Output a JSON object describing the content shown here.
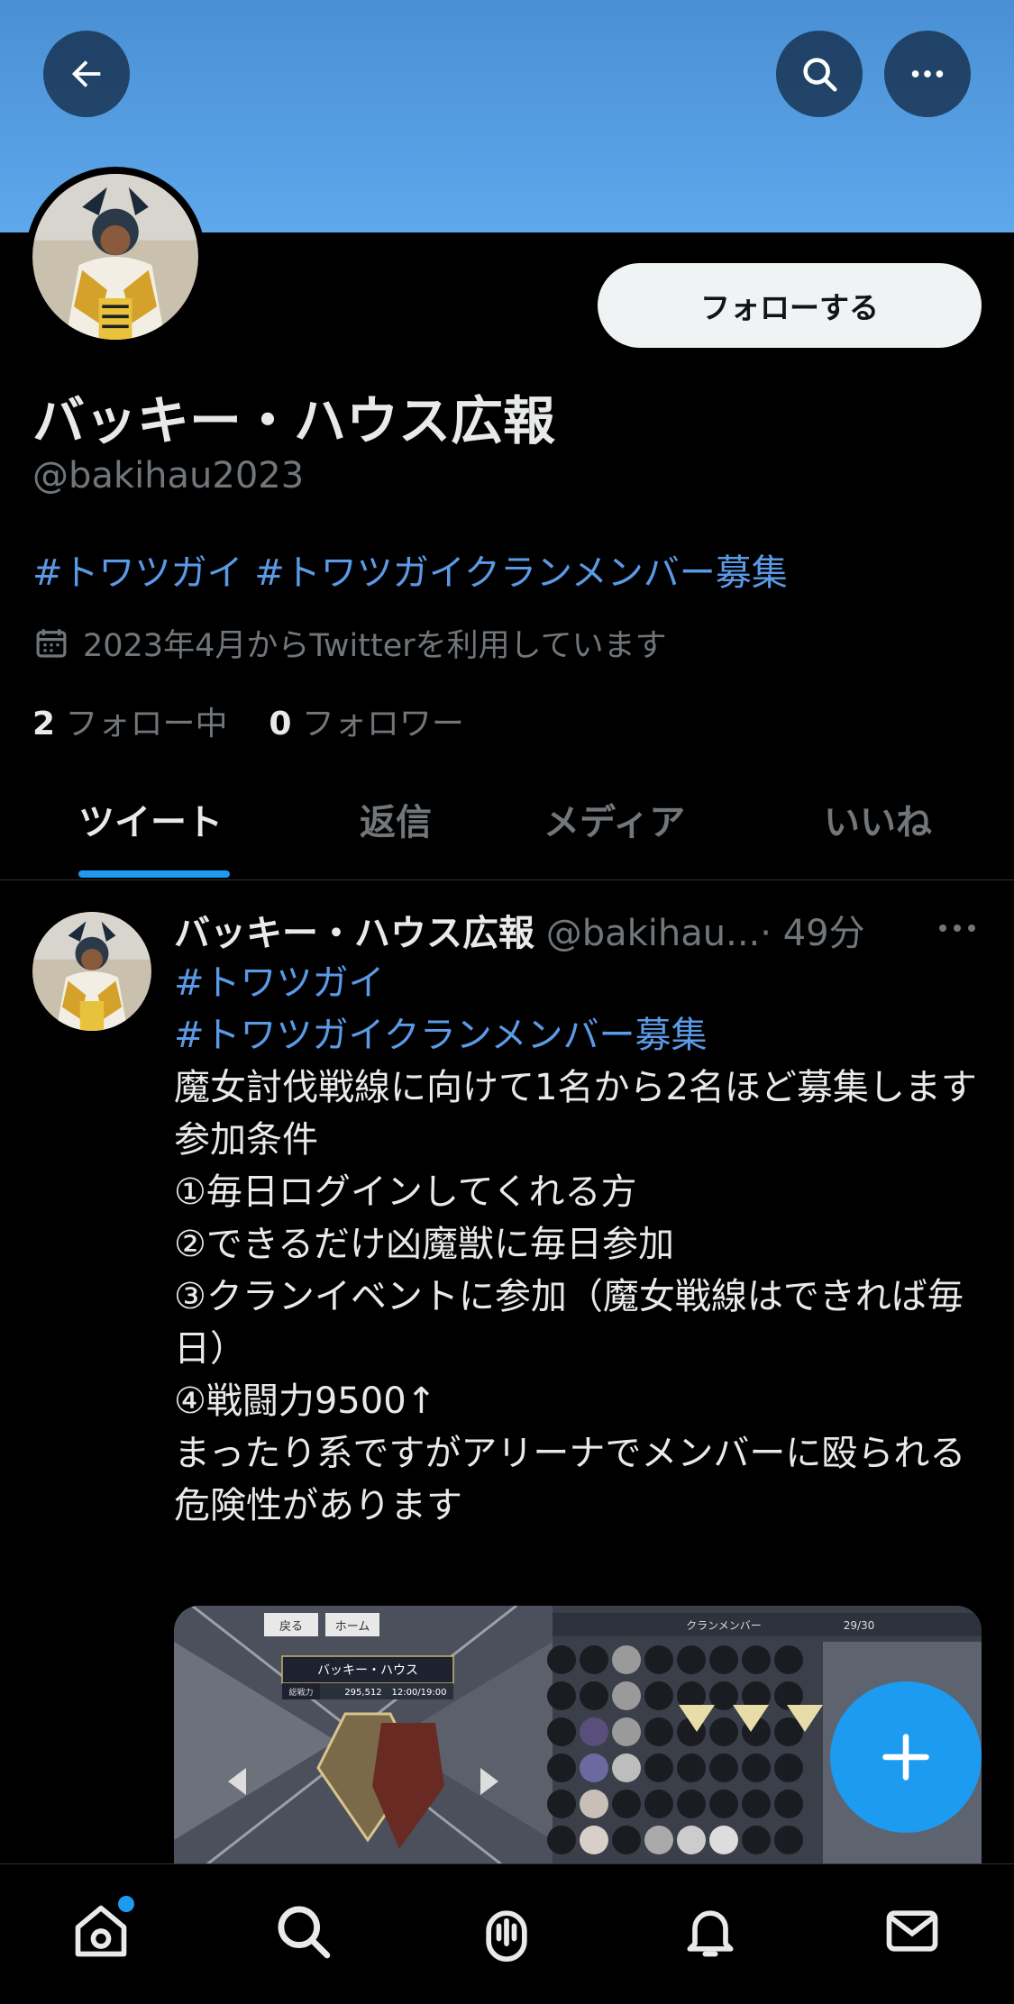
{
  "colors": {
    "accent": "#1d9bf0",
    "link": "#5b9ae6",
    "banner": "#5ea8ec"
  },
  "header": {
    "back_icon": "arrow-left-icon",
    "search_icon": "search-icon",
    "more_icon": "more-horizontal-icon"
  },
  "profile": {
    "follow_label": "フォローする",
    "display_name": "バッキー・ハウス広報",
    "handle": "@bakihau2023",
    "bio": "#トワツガイ #トワツガイクランメンバー募集",
    "joined": "2023年4月からTwitterを利用しています",
    "following_count": "2",
    "following_label": "フォロー中",
    "followers_count": "0",
    "followers_label": "フォロワー"
  },
  "tabs": [
    "ツイート",
    "返信",
    "メディア",
    "いいね"
  ],
  "tweet": {
    "author_name": "バッキー・ハウス広報",
    "author_handle": "@bakihau...",
    "time": "· 49分",
    "hashtag1": "#トワツガイ",
    "hashtag2": "#トワツガイクランメンバー募集",
    "lines": [
      "魔女討伐戦線に向けて1名から2名ほど募集します",
      "参加条件",
      "①毎日ログインしてくれる方",
      "②できるだけ凶魔獣に毎日参加",
      "③クランイベントに参加（魔女戦線はできれば毎日）",
      "④戦闘力9500↑",
      "まったり系ですがアリーナでメンバーに殴られる危険性があります"
    ],
    "media": {
      "back_label": "戻る",
      "home_label": "ホーム",
      "clan_name": "バッキー・ハウス",
      "power_label": "総戦力",
      "power_value": "295,512",
      "time_range": "12:00/19:00",
      "members_label": "クランメンバー",
      "members_count": "29/30"
    }
  },
  "fab_icon": "plus-icon",
  "bottom_nav": [
    "home-icon",
    "search-icon",
    "spaces-icon",
    "notifications-icon",
    "messages-icon"
  ]
}
